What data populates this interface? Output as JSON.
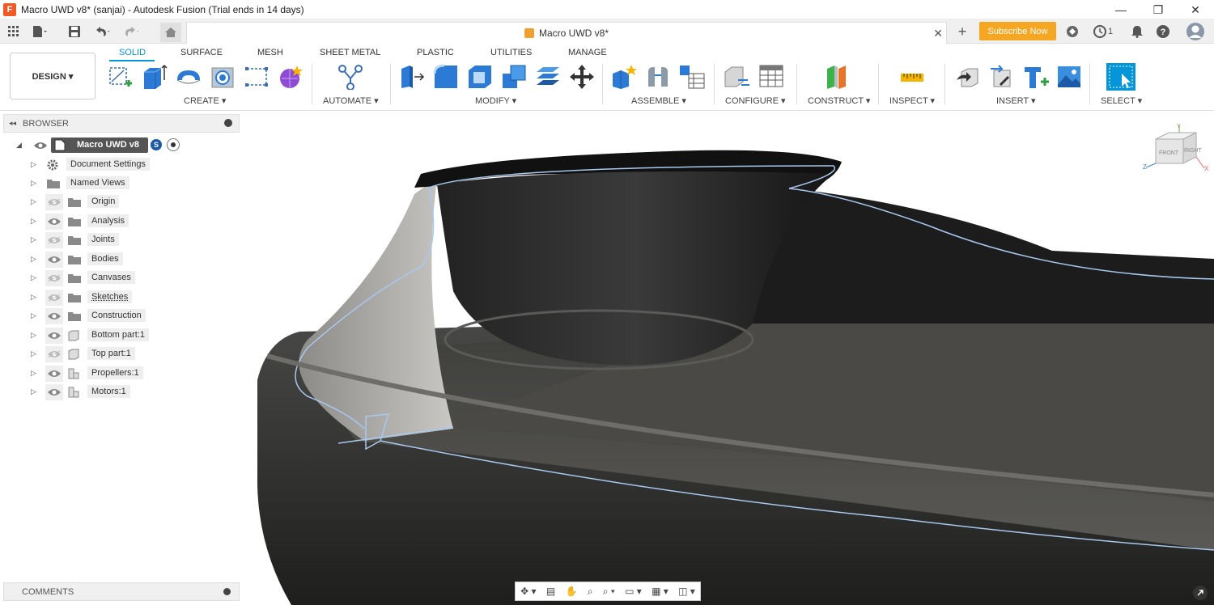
{
  "window": {
    "title": "Macro UWD v8* (sanjai) - Autodesk Fusion (Trial ends in 14 days)",
    "logo": "F",
    "min": "—",
    "max": "❐",
    "close": "✕"
  },
  "tabbar": {
    "doc_title": "Macro UWD v8*",
    "close": "✕",
    "add": "+",
    "subscribe": "Subscribe Now",
    "jobs_count": "1"
  },
  "ribbon": {
    "workspace": "DESIGN ▾",
    "tabs": [
      "SOLID",
      "SURFACE",
      "MESH",
      "SHEET METAL",
      "PLASTIC",
      "UTILITIES",
      "MANAGE"
    ],
    "groups": [
      "CREATE ▾",
      "AUTOMATE ▾",
      "MODIFY ▾",
      "ASSEMBLE ▾",
      "CONFIGURE ▾",
      "CONSTRUCT ▾",
      "INSPECT ▾",
      "INSERT ▾",
      "SELECT ▾"
    ]
  },
  "browser": {
    "title": "BROWSER",
    "root": "Macro UWD v8",
    "items": [
      {
        "label": "Document Settings",
        "icon": "gear-icon"
      },
      {
        "label": "Named Views",
        "icon": "folder-icon"
      },
      {
        "label": "Origin",
        "icon": "folder-icon"
      },
      {
        "label": "Analysis",
        "icon": "folder-icon"
      },
      {
        "label": "Joints",
        "icon": "folder-icon"
      },
      {
        "label": "Bodies",
        "icon": "folder-icon"
      },
      {
        "label": "Canvases",
        "icon": "folder-icon"
      },
      {
        "label": "Sketches",
        "icon": "folder-icon"
      },
      {
        "label": "Construction",
        "icon": "folder-icon"
      },
      {
        "label": "Bottom part:1",
        "icon": "component-icon"
      },
      {
        "label": "Top part:1",
        "icon": "component-icon"
      },
      {
        "label": "Propellers:1",
        "icon": "assembly-icon"
      },
      {
        "label": "Motors:1",
        "icon": "assembly-icon"
      }
    ]
  },
  "comments": {
    "title": "COMMENTS"
  },
  "viewcube": {
    "front": "FRONT",
    "right": "RIGHT",
    "x": "X",
    "y": "Y",
    "z": "Z"
  },
  "colors": {
    "accent": "#0696d7",
    "subscribe": "#f5a623",
    "model": "#2b2b2b"
  }
}
